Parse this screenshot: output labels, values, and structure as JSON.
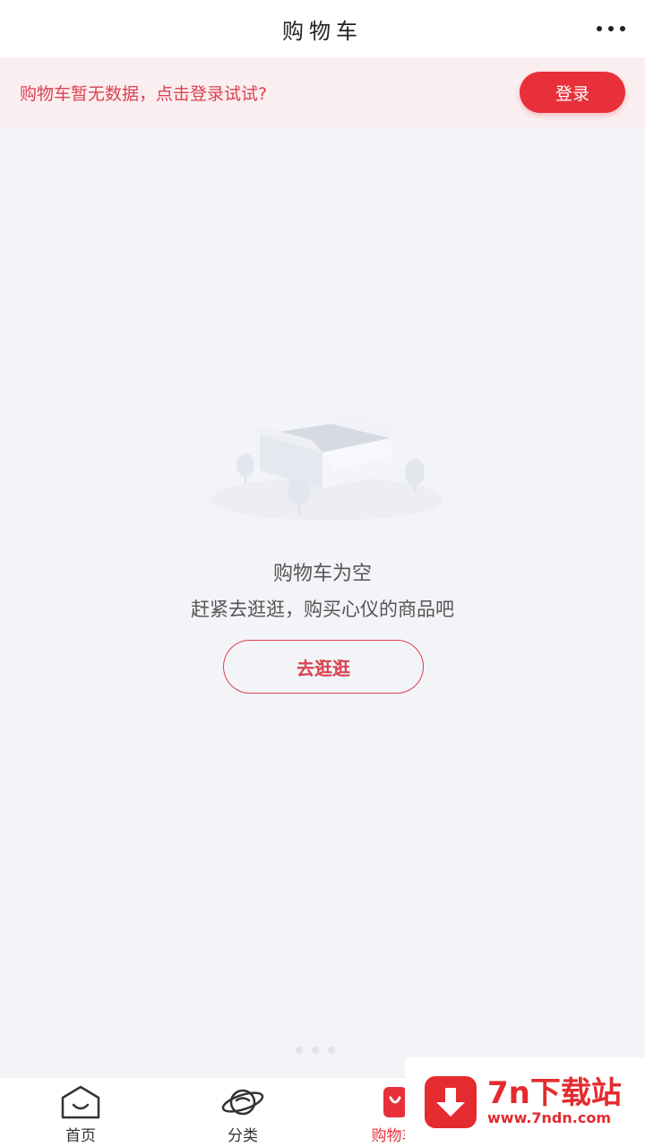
{
  "header": {
    "title": "购物车",
    "more_icon": "more-dots-icon"
  },
  "login_banner": {
    "text": "购物车暂无数据，点击登录试试?",
    "button_label": "登录",
    "accent": "#e7303a"
  },
  "empty_state": {
    "illustration": "empty-box-icon",
    "title": "购物车为空",
    "subtitle": "赶紧去逛逛，购买心仪的商品吧",
    "button_label": "去逛逛"
  },
  "tabbar": {
    "items": [
      {
        "label": "首页",
        "icon": "home-icon",
        "active": false
      },
      {
        "label": "分类",
        "icon": "category-planet-icon",
        "active": false
      },
      {
        "label": "购物车",
        "icon": "cart-icon",
        "active": true
      }
    ]
  },
  "watermark": {
    "title": "7n下载站",
    "url": "www.7ndn.com",
    "icon": "download-arrow-icon"
  }
}
